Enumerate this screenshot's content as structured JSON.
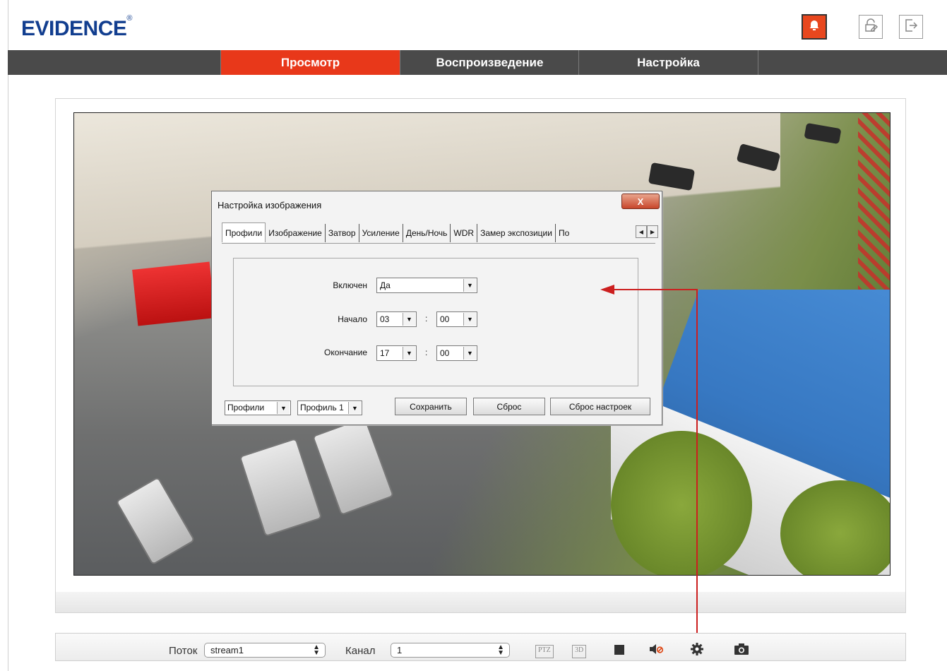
{
  "header": {
    "logo_text": "EVIDENCE",
    "logo_mark": "®",
    "alarm_icon": "bell-icon",
    "lock_icon": "lock-edit-icon",
    "logout_icon": "logout-icon"
  },
  "nav": {
    "tabs": [
      {
        "label": "Просмотр",
        "active": true
      },
      {
        "label": "Воспроизведение",
        "active": false
      },
      {
        "label": "Настройка",
        "active": false
      }
    ]
  },
  "dialog": {
    "title": "Настройка изображения",
    "close_label": "X",
    "tabs": [
      "Профили",
      "Изображение",
      "Затвор",
      "Усиление",
      "День/Ночь",
      "WDR",
      "Замер экспозиции",
      "По"
    ],
    "active_tab": "Профили",
    "enabled_label": "Включен",
    "enabled_value": "Да",
    "start_label": "Начало",
    "start_hour": "03",
    "start_min": "00",
    "end_label": "Окончание",
    "end_hour": "17",
    "end_min": "00",
    "time_separator": ":",
    "profiles_select": "Профили",
    "profile_select": "Профиль 1",
    "save_label": "Сохранить",
    "reset_label": "Сброс",
    "factory_reset_label": "Сброс настроек"
  },
  "toolbar": {
    "stream_label": "Поток",
    "stream_value": "stream1",
    "channel_label": "Канал",
    "channel_value": "1",
    "ptz_label": "PTZ",
    "threed_label": "3D",
    "icons": [
      "ptz-icon",
      "3d-icon",
      "record-stop-icon",
      "mute-icon",
      "settings-gear-icon",
      "snapshot-camera-icon"
    ]
  },
  "colors": {
    "accent": "#e8381a",
    "nav_bg": "#4a4a4a",
    "logo": "#123e8f",
    "annotation": "#cc1f1f"
  }
}
